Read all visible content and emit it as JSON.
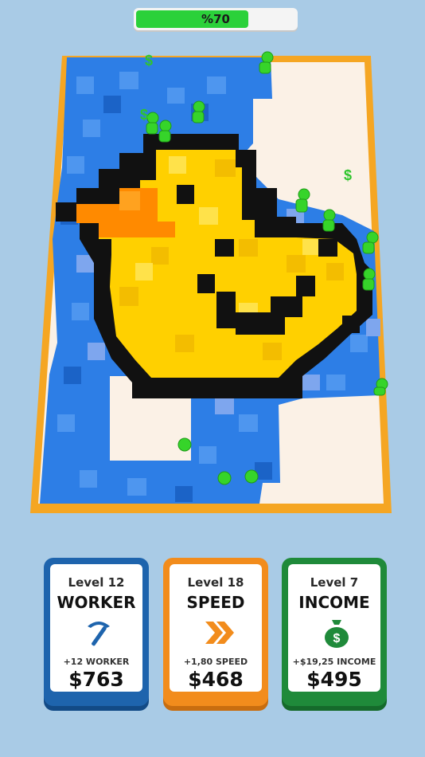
{
  "progress": {
    "label": "%70",
    "fraction": 0.7,
    "color": "#2bd13a"
  },
  "board": {
    "frame_color": "#f5a623",
    "floor_color": "#fbf1e6",
    "block_color": "#2d7ee6",
    "duck_color": "#ffd000",
    "beak_color": "#ff8a00",
    "outline_color": "#111111",
    "worker_color": "#36d42a",
    "dollar_color": "#2fc52d",
    "dollar_symbol": "$"
  },
  "cards": [
    {
      "id": "worker",
      "level": "Level 12",
      "title": "WORKER",
      "icon": "pickaxe-icon",
      "gain": "+12 WORKER",
      "price": "$763",
      "color": "#1e64ad"
    },
    {
      "id": "speed",
      "level": "Level 18",
      "title": "SPEED",
      "icon": "double-chevron-icon",
      "gain": "+1,80 SPEED",
      "price": "$468",
      "color": "#f28c1c"
    },
    {
      "id": "income",
      "level": "Level 7",
      "title": "INCOME",
      "icon": "money-bag-icon",
      "gain": "+$19,25 INCOME",
      "price": "$495",
      "color": "#1f8a3a"
    }
  ]
}
